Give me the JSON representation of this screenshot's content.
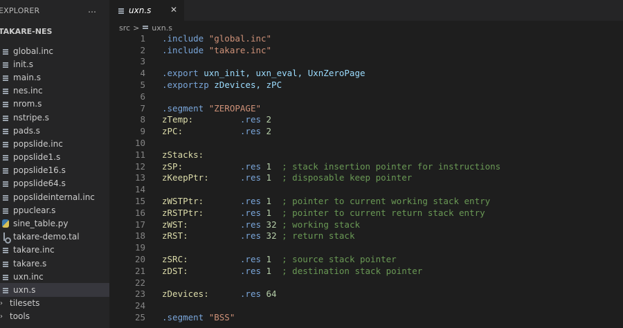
{
  "sidebar": {
    "title": "EXPLORER",
    "more": "…",
    "project": "TAKARE-NES",
    "files": [
      {
        "name": "global.inc",
        "icon": "lines-file-icon",
        "selected": false
      },
      {
        "name": "init.s",
        "icon": "lines-file-icon",
        "selected": false
      },
      {
        "name": "main.s",
        "icon": "lines-file-icon",
        "selected": false
      },
      {
        "name": "nes.inc",
        "icon": "lines-file-icon",
        "selected": false
      },
      {
        "name": "nrom.s",
        "icon": "lines-file-icon",
        "selected": false
      },
      {
        "name": "nstripe.s",
        "icon": "lines-file-icon",
        "selected": false
      },
      {
        "name": "pads.s",
        "icon": "lines-file-icon",
        "selected": false
      },
      {
        "name": "popslide.inc",
        "icon": "lines-file-icon",
        "selected": false
      },
      {
        "name": "popslide1.s",
        "icon": "lines-file-icon",
        "selected": false
      },
      {
        "name": "popslide16.s",
        "icon": "lines-file-icon",
        "selected": false
      },
      {
        "name": "popslide64.s",
        "icon": "lines-file-icon",
        "selected": false
      },
      {
        "name": "popslideinternal.inc",
        "icon": "lines-file-icon",
        "selected": false
      },
      {
        "name": "ppuclear.s",
        "icon": "lines-file-icon",
        "selected": false
      },
      {
        "name": "sine_table.py",
        "icon": "python-file-icon",
        "selected": false
      },
      {
        "name": "takare-demo.tal",
        "icon": "tal-file-icon",
        "selected": false
      },
      {
        "name": "takare.inc",
        "icon": "lines-file-icon",
        "selected": false
      },
      {
        "name": "takare.s",
        "icon": "lines-file-icon",
        "selected": false
      },
      {
        "name": "uxn.inc",
        "icon": "lines-file-icon",
        "selected": false
      },
      {
        "name": "uxn.s",
        "icon": "lines-file-icon",
        "selected": true
      }
    ],
    "folders": [
      {
        "name": "tilesets",
        "chevron": "›"
      },
      {
        "name": "tools",
        "chevron": "›"
      }
    ]
  },
  "tab": {
    "label": "uxn.s",
    "close": "✕"
  },
  "breadcrumb": {
    "folder": "src",
    "sep": ">",
    "file": "uxn.s"
  },
  "code": [
    {
      "n": "1",
      "segs": [
        [
          ".include ",
          "dir"
        ],
        [
          "\"global.inc\"",
          "str"
        ]
      ]
    },
    {
      "n": "2",
      "segs": [
        [
          ".include ",
          "dir"
        ],
        [
          "\"takare.inc\"",
          "str"
        ]
      ]
    },
    {
      "n": "3",
      "segs": []
    },
    {
      "n": "4",
      "segs": [
        [
          ".export ",
          "dir"
        ],
        [
          "uxn_init, uxn_eval, UxnZeroPage",
          "sym"
        ]
      ]
    },
    {
      "n": "5",
      "segs": [
        [
          ".exportzp ",
          "dir"
        ],
        [
          "zDevices, zPC",
          "sym"
        ]
      ]
    },
    {
      "n": "6",
      "segs": []
    },
    {
      "n": "7",
      "segs": [
        [
          ".segment ",
          "dir"
        ],
        [
          "\"ZEROPAGE\"",
          "str"
        ]
      ]
    },
    {
      "n": "8",
      "segs": [
        [
          "zTemp:",
          "lbl"
        ],
        [
          "         ",
          "plain"
        ],
        [
          ".res ",
          "dir"
        ],
        [
          "2",
          "num"
        ]
      ]
    },
    {
      "n": "9",
      "segs": [
        [
          "zPC:",
          "lbl"
        ],
        [
          "           ",
          "plain"
        ],
        [
          ".res ",
          "dir"
        ],
        [
          "2",
          "num"
        ]
      ]
    },
    {
      "n": "10",
      "segs": []
    },
    {
      "n": "11",
      "segs": [
        [
          "zStacks:",
          "lbl"
        ]
      ]
    },
    {
      "n": "12",
      "segs": [
        [
          "zSP:",
          "lbl"
        ],
        [
          "           ",
          "plain"
        ],
        [
          ".res ",
          "dir"
        ],
        [
          "1  ",
          "num"
        ],
        [
          "; stack insertion pointer for instructions",
          "com"
        ]
      ]
    },
    {
      "n": "13",
      "segs": [
        [
          "zKeepPtr:",
          "lbl"
        ],
        [
          "      ",
          "plain"
        ],
        [
          ".res ",
          "dir"
        ],
        [
          "1  ",
          "num"
        ],
        [
          "; disposable keep pointer",
          "com"
        ]
      ]
    },
    {
      "n": "14",
      "segs": []
    },
    {
      "n": "15",
      "segs": [
        [
          "zWSTPtr:",
          "lbl"
        ],
        [
          "       ",
          "plain"
        ],
        [
          ".res ",
          "dir"
        ],
        [
          "1  ",
          "num"
        ],
        [
          "; pointer to current working stack entry",
          "com"
        ]
      ]
    },
    {
      "n": "16",
      "segs": [
        [
          "zRSTPtr:",
          "lbl"
        ],
        [
          "       ",
          "plain"
        ],
        [
          ".res ",
          "dir"
        ],
        [
          "1  ",
          "num"
        ],
        [
          "; pointer to current return stack entry",
          "com"
        ]
      ]
    },
    {
      "n": "17",
      "segs": [
        [
          "zWST:",
          "lbl"
        ],
        [
          "          ",
          "plain"
        ],
        [
          ".res ",
          "dir"
        ],
        [
          "32 ",
          "num"
        ],
        [
          "; working stack",
          "com"
        ]
      ]
    },
    {
      "n": "18",
      "segs": [
        [
          "zRST:",
          "lbl"
        ],
        [
          "          ",
          "plain"
        ],
        [
          ".res ",
          "dir"
        ],
        [
          "32 ",
          "num"
        ],
        [
          "; return stack",
          "com"
        ]
      ]
    },
    {
      "n": "19",
      "segs": []
    },
    {
      "n": "20",
      "segs": [
        [
          "zSRC:",
          "lbl"
        ],
        [
          "          ",
          "plain"
        ],
        [
          ".res ",
          "dir"
        ],
        [
          "1  ",
          "num"
        ],
        [
          "; source stack pointer",
          "com"
        ]
      ]
    },
    {
      "n": "21",
      "segs": [
        [
          "zDST:",
          "lbl"
        ],
        [
          "          ",
          "plain"
        ],
        [
          ".res ",
          "dir"
        ],
        [
          "1  ",
          "num"
        ],
        [
          "; destination stack pointer",
          "com"
        ]
      ]
    },
    {
      "n": "22",
      "segs": []
    },
    {
      "n": "23",
      "segs": [
        [
          "zDevices:",
          "lbl"
        ],
        [
          "      ",
          "plain"
        ],
        [
          ".res ",
          "dir"
        ],
        [
          "64",
          "num"
        ]
      ]
    },
    {
      "n": "24",
      "segs": []
    },
    {
      "n": "25",
      "segs": [
        [
          ".segment ",
          "dir"
        ],
        [
          "\"BSS\"",
          "str"
        ]
      ]
    }
  ],
  "colors": {
    "sidebar_bg": "#252526",
    "editor_bg": "#1e1e1e",
    "selected_row": "#37373d"
  }
}
